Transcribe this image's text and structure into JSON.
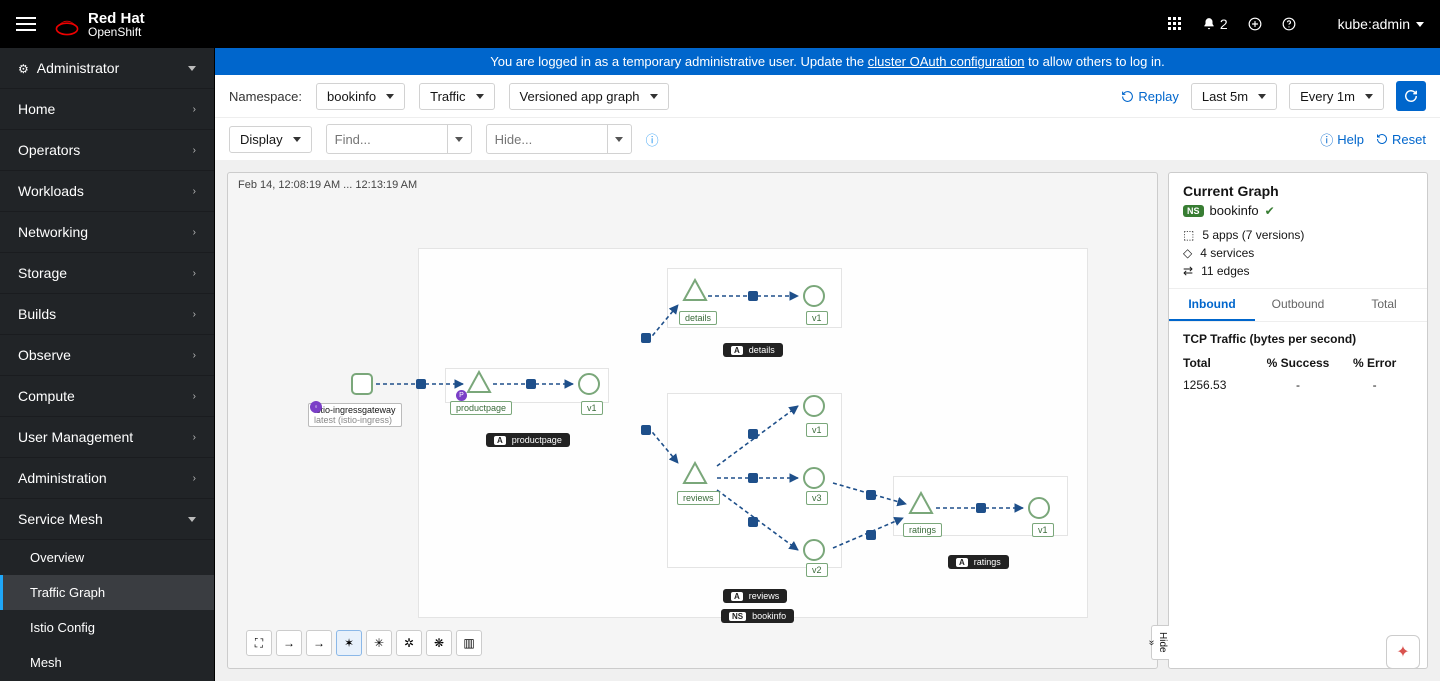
{
  "brand": {
    "line1": "Red Hat",
    "line2": "OpenShift"
  },
  "topbar": {
    "notif_count": "2",
    "user": "kube:admin"
  },
  "sidebar": {
    "perspective": "Administrator",
    "items": [
      "Home",
      "Operators",
      "Workloads",
      "Networking",
      "Storage",
      "Builds",
      "Observe",
      "Compute",
      "User Management",
      "Administration"
    ],
    "mesh_section": "Service Mesh",
    "mesh_items": [
      "Overview",
      "Traffic Graph",
      "Istio Config",
      "Mesh"
    ],
    "active_mesh": "Traffic Graph"
  },
  "alert": {
    "prefix": "You are logged in as a temporary administrative user. Update the ",
    "link": "cluster OAuth configuration",
    "suffix": " to allow others to log in."
  },
  "toolbar1": {
    "ns_label": "Namespace:",
    "ns_value": "bookinfo",
    "traffic": "Traffic",
    "graph_type": "Versioned app graph",
    "replay": "Replay",
    "range": "Last 5m",
    "interval": "Every 1m"
  },
  "toolbar2": {
    "display": "Display",
    "find_ph": "Find...",
    "hide_ph": "Hide...",
    "help": "Help",
    "reset": "Reset"
  },
  "canvas": {
    "time": "Feb 14, 12:08:19 AM ... 12:13:19 AM"
  },
  "graph": {
    "gateway": {
      "name": "istio-ingressgateway",
      "sub": "latest (istio-ingress)"
    },
    "nodes": {
      "productpage": "productpage",
      "details": "details",
      "reviews": "reviews",
      "ratings": "ratings",
      "v1": "v1",
      "v2": "v2",
      "v3": "v3"
    },
    "pills": {
      "productpage": "productpage",
      "details": "details",
      "reviews": "reviews",
      "ratings": "ratings",
      "bookinfo": "bookinfo",
      "A": "A",
      "NS": "NS"
    }
  },
  "panel": {
    "title": "Current Graph",
    "ns": "bookinfo",
    "apps": "5 apps (7 versions)",
    "services": "4 services",
    "edges": "11 edges",
    "tabs": [
      "Inbound",
      "Outbound",
      "Total"
    ],
    "metric_title": "TCP Traffic (bytes per second)",
    "cols": [
      "Total",
      "% Success",
      "% Error"
    ],
    "row": [
      "1256.53",
      "-",
      "-"
    ],
    "hide": "Hide"
  }
}
